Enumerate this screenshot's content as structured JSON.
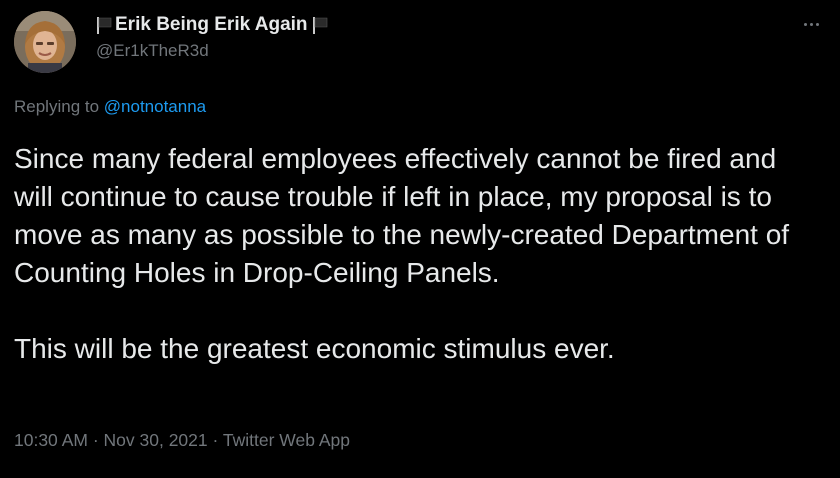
{
  "author": {
    "display_name": "Erik Being Erik Again",
    "handle": "@Er1kTheR3d",
    "avatar_icon": "profile-photo",
    "name_emoji": "black-flag-icon"
  },
  "menu": {
    "more_icon": "ellipsis-icon"
  },
  "reply": {
    "prefix": "Replying to ",
    "mention": "@notnotanna"
  },
  "tweet": {
    "paragraphs": [
      "Since many federal employees effectively cannot be fired and will continue to cause trouble if left in place, my proposal is to move as many as possible to the newly-created Department of Counting Holes in Drop-Ceiling Panels.",
      "This will be the greatest economic stimulus ever."
    ]
  },
  "meta": {
    "time": "10:30 AM",
    "separator": " · ",
    "date": "Nov 30, 2021",
    "source": "Twitter Web App"
  },
  "colors": {
    "background": "#000000",
    "text_primary": "#e7e9ea",
    "text_secondary": "#71767b",
    "link": "#1d9bf0"
  }
}
